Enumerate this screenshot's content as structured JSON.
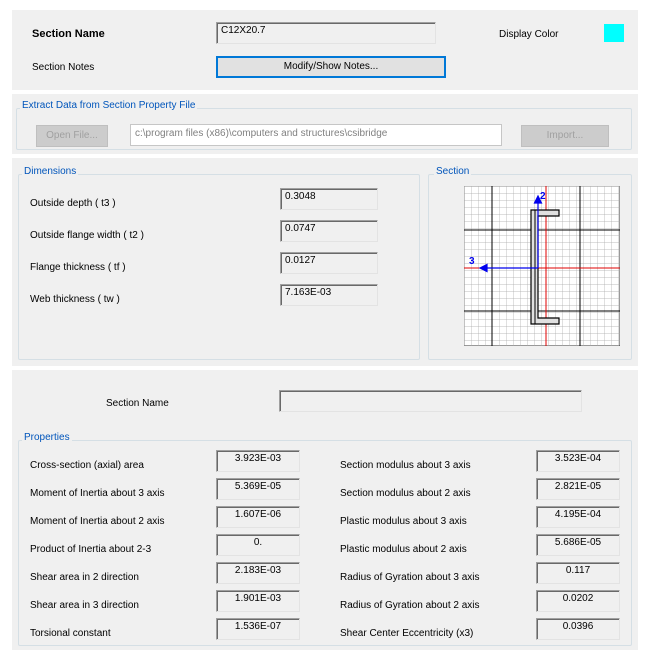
{
  "top": {
    "section_name_label": "Section Name",
    "section_name_value": "C12X20.7",
    "display_color_label": "Display Color",
    "display_color": "#00ffff",
    "section_notes_label": "Section Notes",
    "modify_notes_button": "Modify/Show Notes..."
  },
  "extract": {
    "title": "Extract Data from Section Property File",
    "open_file_button": "Open File...",
    "file_path": "c:\\program files (x86)\\computers and structures\\csibridge",
    "import_button": "Import..."
  },
  "dimensions": {
    "title": "Dimensions",
    "rows": [
      {
        "label": "Outside depth  ( t3 )",
        "value": "0.3048"
      },
      {
        "label": "Outside flange width  ( t2 )",
        "value": "0.0747"
      },
      {
        "label": "Flange thickness  ( tf )",
        "value": "0.0127"
      },
      {
        "label": "Web thickness  ( tw )",
        "value": "7.163E-03"
      }
    ]
  },
  "section_preview": {
    "title": "Section",
    "axis_2_label": "2",
    "axis_3_label": "3"
  },
  "properties_panel": {
    "section_name_label": "Section Name",
    "section_name_value": "",
    "title": "Properties",
    "left": [
      {
        "label": "Cross-section (axial) area",
        "value": "3.923E-03"
      },
      {
        "label": "Moment of Inertia about 3 axis",
        "value": "5.369E-05"
      },
      {
        "label": "Moment of Inertia about 2 axis",
        "value": "1.607E-06"
      },
      {
        "label": "Product of Inertia about 2-3",
        "value": "0."
      },
      {
        "label": "Shear area in 2 direction",
        "value": "2.183E-03"
      },
      {
        "label": "Shear area in 3 direction",
        "value": "1.901E-03"
      },
      {
        "label": "Torsional constant",
        "value": "1.536E-07"
      }
    ],
    "right": [
      {
        "label": "Section modulus about 3 axis",
        "value": "3.523E-04"
      },
      {
        "label": "Section modulus about 2 axis",
        "value": "2.821E-05"
      },
      {
        "label": "Plastic modulus about 3 axis",
        "value": "4.195E-04"
      },
      {
        "label": "Plastic modulus about 2 axis",
        "value": "5.686E-05"
      },
      {
        "label": "Radius of Gyration about 3 axis",
        "value": "0.117"
      },
      {
        "label": "Radius of Gyration about 2 axis",
        "value": "0.0202"
      },
      {
        "label": "Shear Center Eccentricity (x3)",
        "value": "0.0396"
      }
    ]
  }
}
